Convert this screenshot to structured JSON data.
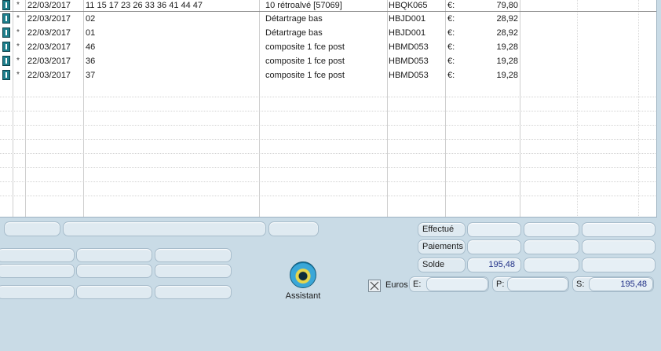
{
  "rows": [
    {
      "date": "22/03/2017",
      "teeth": "11 15 17 23 26 33 36 41 44 47",
      "act": "10 rétroalvé [57069]",
      "code": "HBQK065",
      "cur": "€:",
      "amount": "79,80"
    },
    {
      "date": "22/03/2017",
      "teeth": "02",
      "act": "Détartrage bas",
      "code": "HBJD001",
      "cur": "€:",
      "amount": "28,92"
    },
    {
      "date": "22/03/2017",
      "teeth": "01",
      "act": "Détartrage bas",
      "code": "HBJD001",
      "cur": "€:",
      "amount": "28,92"
    },
    {
      "date": "22/03/2017",
      "teeth": "46",
      "act": "composite 1 fce post",
      "code": "HBMD053",
      "cur": "€:",
      "amount": "19,28"
    },
    {
      "date": "22/03/2017",
      "teeth": "36",
      "act": "composite 1 fce post",
      "code": "HBMD053",
      "cur": "€:",
      "amount": "19,28"
    },
    {
      "date": "22/03/2017",
      "teeth": "37",
      "act": "composite 1 fce post",
      "code": "HBMD053",
      "cur": "€:",
      "amount": "19,28"
    }
  ],
  "row_marker": "*",
  "summary": {
    "effectue_label": "Effectué",
    "paiements_label": "Paiements",
    "solde_label": "Solde",
    "solde_value": "195,48"
  },
  "euros": {
    "label": "Euros",
    "checked": true,
    "e_label": "E:",
    "p_label": "P:",
    "s_label": "S:",
    "s_value": "195,48"
  },
  "assistant": {
    "label": "Assistant",
    "icon": "assistant-icon"
  }
}
